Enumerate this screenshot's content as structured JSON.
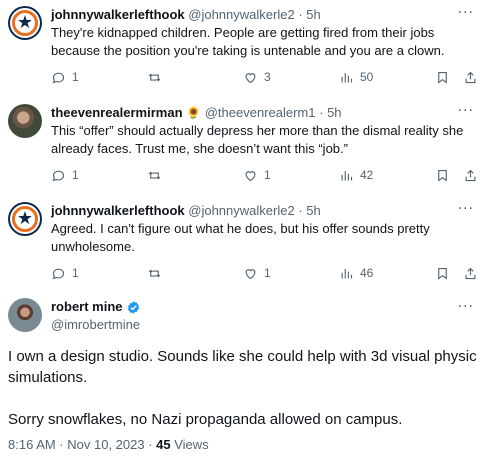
{
  "replies": [
    {
      "name": "johnnywalkerlefthook",
      "handle": "@johnnywalkerle2",
      "dot": "·",
      "time": "5h",
      "text": "They're kidnapped children. People are getting fired from their jobs because the position you're taking is untenable and you are a clown.",
      "replies": "1",
      "retweets": "",
      "likes": "3",
      "views": "50",
      "avatar_icon": "astros-logo-icon"
    },
    {
      "name": "theevenrealermirman",
      "emoji": "🌻",
      "handle": "@theevenrealerm1",
      "dot": "·",
      "time": "5h",
      "text": "This “offer” should actually depress her more than the dismal reality she already faces. Trust me, she doesn’t want this “job.”",
      "replies": "1",
      "retweets": "",
      "likes": "1",
      "views": "42",
      "avatar_icon": "profile-photo-icon"
    },
    {
      "name": "johnnywalkerlefthook",
      "handle": "@johnnywalkerle2",
      "dot": "·",
      "time": "5h",
      "text": "Agreed. I can't figure out what he does, but his offer sounds pretty unwholesome.",
      "replies": "1",
      "retweets": "",
      "likes": "1",
      "views": "46",
      "avatar_icon": "astros-logo-icon"
    }
  ],
  "main_post": {
    "name": "robert mine",
    "handle": "@imrobertmine",
    "paragraph1": "I own a design studio. Sounds like she could help with 3d visual physic simulations.",
    "paragraph2": "Sorry snowflakes, no Nazi propaganda allowed on campus.",
    "timestamp": "8:16 AM · Nov 10, 2023 · ",
    "views_count": "45",
    "views_label": " Views"
  },
  "more_glyph": "···",
  "colors": {
    "text_primary": "#0f1419",
    "text_secondary": "#536471",
    "verified_blue": "#1d9bf0",
    "astros_navy": "#0b2a4a",
    "astros_orange": "#eb6e1f"
  }
}
